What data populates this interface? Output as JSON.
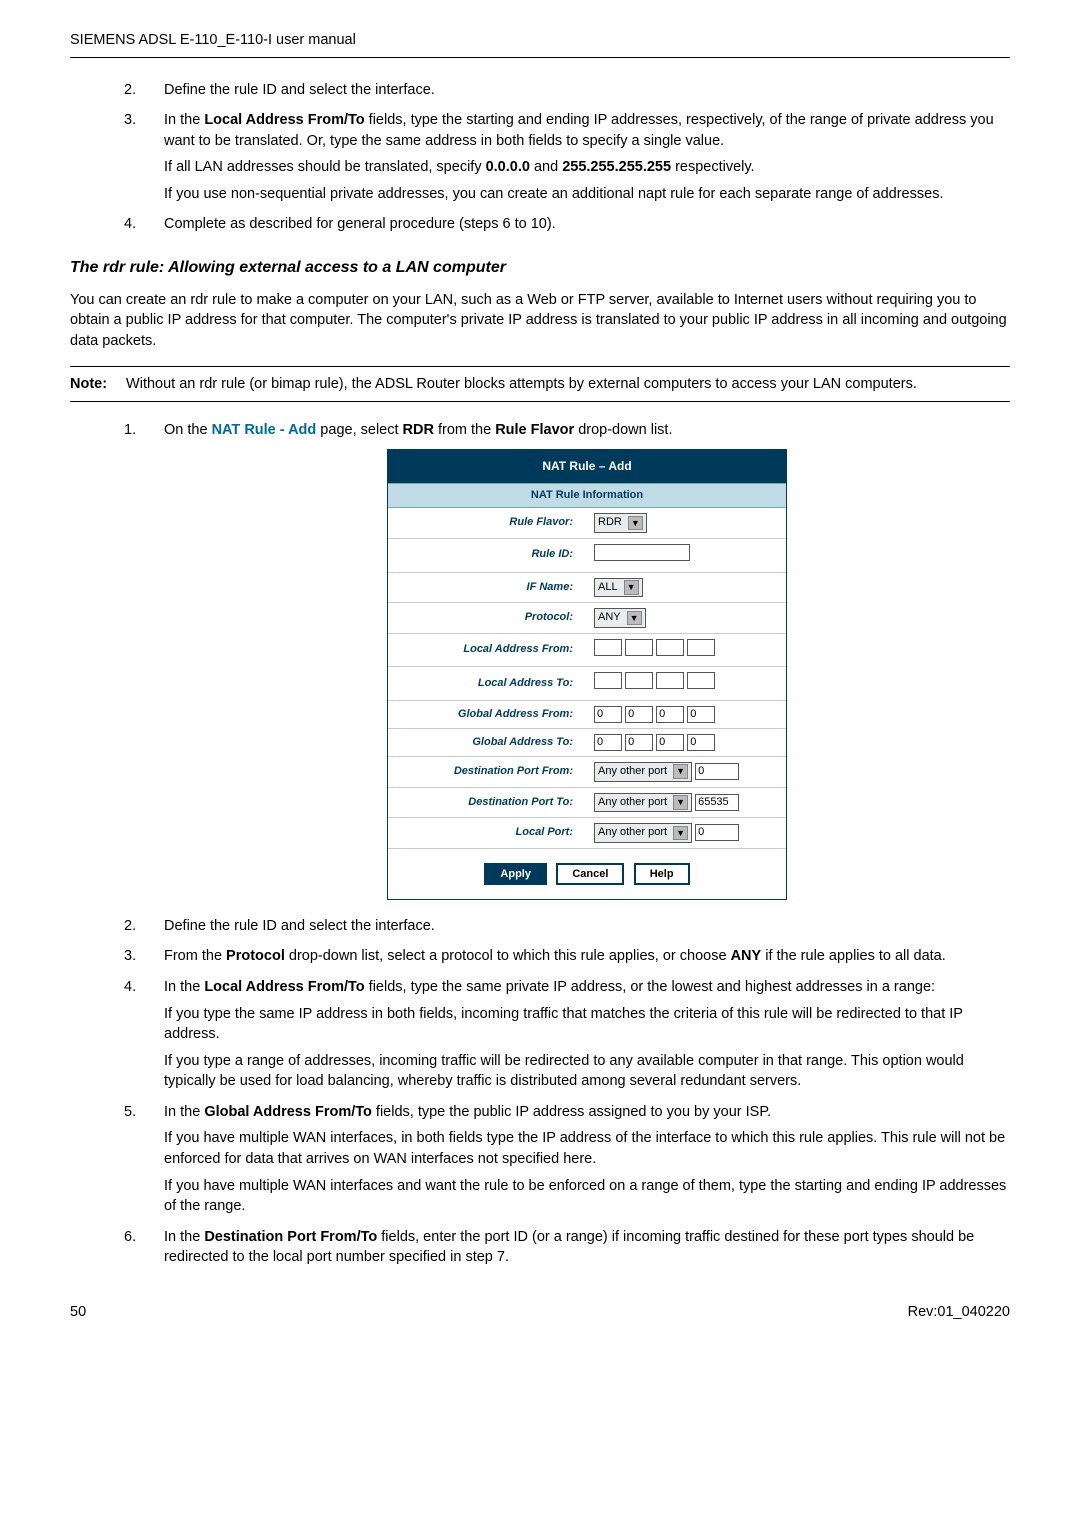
{
  "header": {
    "title": "SIEMENS ADSL E-110_E-110-I user manual"
  },
  "intro": {
    "items": [
      {
        "num": "2.",
        "text": "Define the rule ID and select the interface."
      },
      {
        "num": "3.",
        "text_prefix": "In the ",
        "bold1": "Local Address From/To",
        "text_mid": " fields, type the starting and ending IP addresses, respectively, of the range of private address you want to be translated. Or, type the same address in both fields to specify a single value.",
        "sub1_prefix": "If all LAN addresses should be translated, specify ",
        "sub1_bold1": "0.0.0.0",
        "sub1_mid": " and ",
        "sub1_bold2": "255.255.255.255",
        "sub1_suffix": " respectively.",
        "sub2": "If you use non-sequential private addresses, you can create an additional napt rule for each separate range of addresses."
      },
      {
        "num": "4.",
        "text": "Complete as described for general procedure (steps 6 to 10)."
      }
    ]
  },
  "section_heading": "The rdr rule: Allowing external access to a LAN computer",
  "section_para": "You can create an rdr rule to make a computer on your LAN, such as a Web or FTP server, available to Internet users without requiring you to obtain a public IP address for that computer. The computer's private IP address is translated to your public IP address in all incoming and outgoing data packets.",
  "note": {
    "label": "Note:",
    "text": "Without an rdr rule (or bimap rule), the ADSL Router blocks attempts by external computers to access your LAN computers."
  },
  "step1": {
    "num": "1.",
    "prefix": "On the ",
    "link": "NAT Rule - Add",
    "mid": " page, select ",
    "bold1": "RDR",
    "mid2": " from the ",
    "bold2": "Rule Flavor",
    "suffix": " drop-down list."
  },
  "shot": {
    "title": "NAT Rule – Add",
    "section": "NAT Rule Information",
    "rows": {
      "rule_flavor": {
        "label": "Rule Flavor:",
        "value": "RDR"
      },
      "rule_id": {
        "label": "Rule ID:"
      },
      "if_name": {
        "label": "IF Name:",
        "value": "ALL"
      },
      "protocol": {
        "label": "Protocol:",
        "value": "ANY"
      },
      "local_from": {
        "label": "Local Address From:"
      },
      "local_to": {
        "label": "Local Address To:"
      },
      "global_from": {
        "label": "Global Address From:",
        "v1": "0",
        "v2": "0",
        "v3": "0",
        "v4": "0"
      },
      "global_to": {
        "label": "Global Address To:",
        "v1": "0",
        "v2": "0",
        "v3": "0",
        "v4": "0"
      },
      "dest_port_from": {
        "label": "Destination Port From:",
        "sel": "Any other port",
        "value": "0"
      },
      "dest_port_to": {
        "label": "Destination Port To:",
        "sel": "Any other port",
        "value": "65535"
      },
      "local_port": {
        "label": "Local Port:",
        "sel": "Any other port",
        "value": "0"
      }
    },
    "buttons": {
      "apply": "Apply",
      "cancel": "Cancel",
      "help": "Help"
    }
  },
  "steps_after": [
    {
      "num": "2.",
      "text": "Define the rule ID and select the interface."
    },
    {
      "num": "3.",
      "prefix": "From the ",
      "bold1": "Protocol",
      "mid": " drop-down list, select a protocol to which this rule applies, or choose ",
      "bold2": "ANY",
      "suffix": " if the rule applies to all data."
    },
    {
      "num": "4.",
      "prefix": "In the ",
      "bold1": "Local Address From/To",
      "suffix": " fields, type the same private IP address, or the lowest and highest addresses in a range:",
      "sub1": "If you type the same IP address in both fields, incoming traffic that matches the criteria of this rule will be redirected to that IP address.",
      "sub2": "If you type a range of addresses, incoming traffic will be redirected to any available computer in that range. This option would typically be used for load balancing, whereby traffic is distributed among several redundant servers."
    },
    {
      "num": "5.",
      "prefix": "In the ",
      "bold1": "Global Address From/To",
      "suffix": " fields, type the public IP address assigned to you by your ISP.",
      "sub1": "If you have multiple WAN interfaces, in both fields type the IP address of the interface to which this rule applies. This rule will not be enforced for data that arrives on WAN interfaces not specified here.",
      "sub2": "If you have multiple WAN interfaces and want the rule to be enforced on a range of them, type the starting and ending IP addresses of the range."
    },
    {
      "num": "6.",
      "prefix": "In the ",
      "bold1": "Destination Port From/To",
      "suffix": " fields, enter the port ID (or a range) if incoming traffic destined for these port types should be redirected to the local port number specified in step 7."
    }
  ],
  "footer": {
    "page": "50",
    "rev": "Rev:01_040220"
  }
}
